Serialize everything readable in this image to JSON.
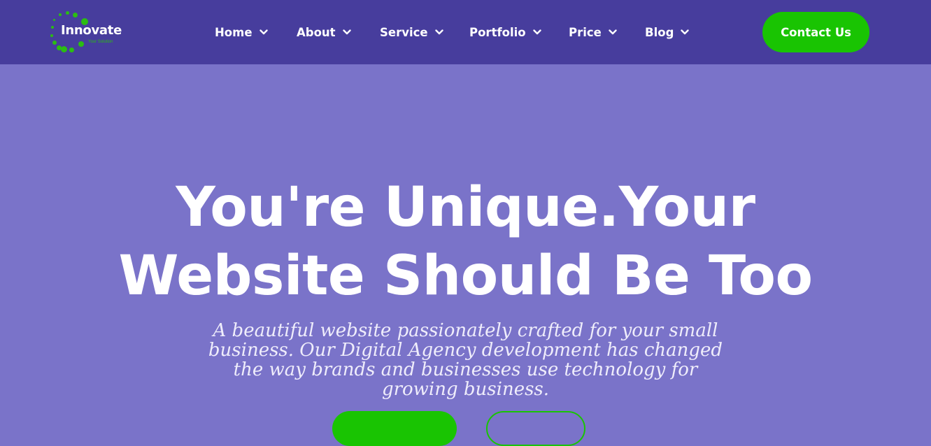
{
  "colors": {
    "navbar_bg": "#473d9d",
    "hero_bg": "#7a73c9",
    "accent_green": "#19c402",
    "text_white": "#ffffff"
  },
  "logo": {
    "name": "Innovate",
    "tagline": "Your Solution",
    "icon": "dotted-circle-icon"
  },
  "nav": {
    "items": [
      {
        "label": "Home",
        "icon": "chevron-down-icon"
      },
      {
        "label": "About",
        "icon": "chevron-down-icon"
      },
      {
        "label": "Service",
        "icon": "chevron-down-icon"
      },
      {
        "label": "Portfolio",
        "icon": "chevron-down-icon"
      },
      {
        "label": "Price",
        "icon": "chevron-down-icon"
      },
      {
        "label": "Blog",
        "icon": "chevron-down-icon"
      }
    ],
    "contact_label": "Contact Us"
  },
  "hero": {
    "title_lines": [
      "You're Unique.Your",
      "Website Should Be Too"
    ],
    "subtitle_lines": [
      "A beautiful website passionately crafted for your small",
      "business. Our Digital Agency development has changed",
      "the way brands and businesses use technology for",
      "growing business."
    ]
  }
}
